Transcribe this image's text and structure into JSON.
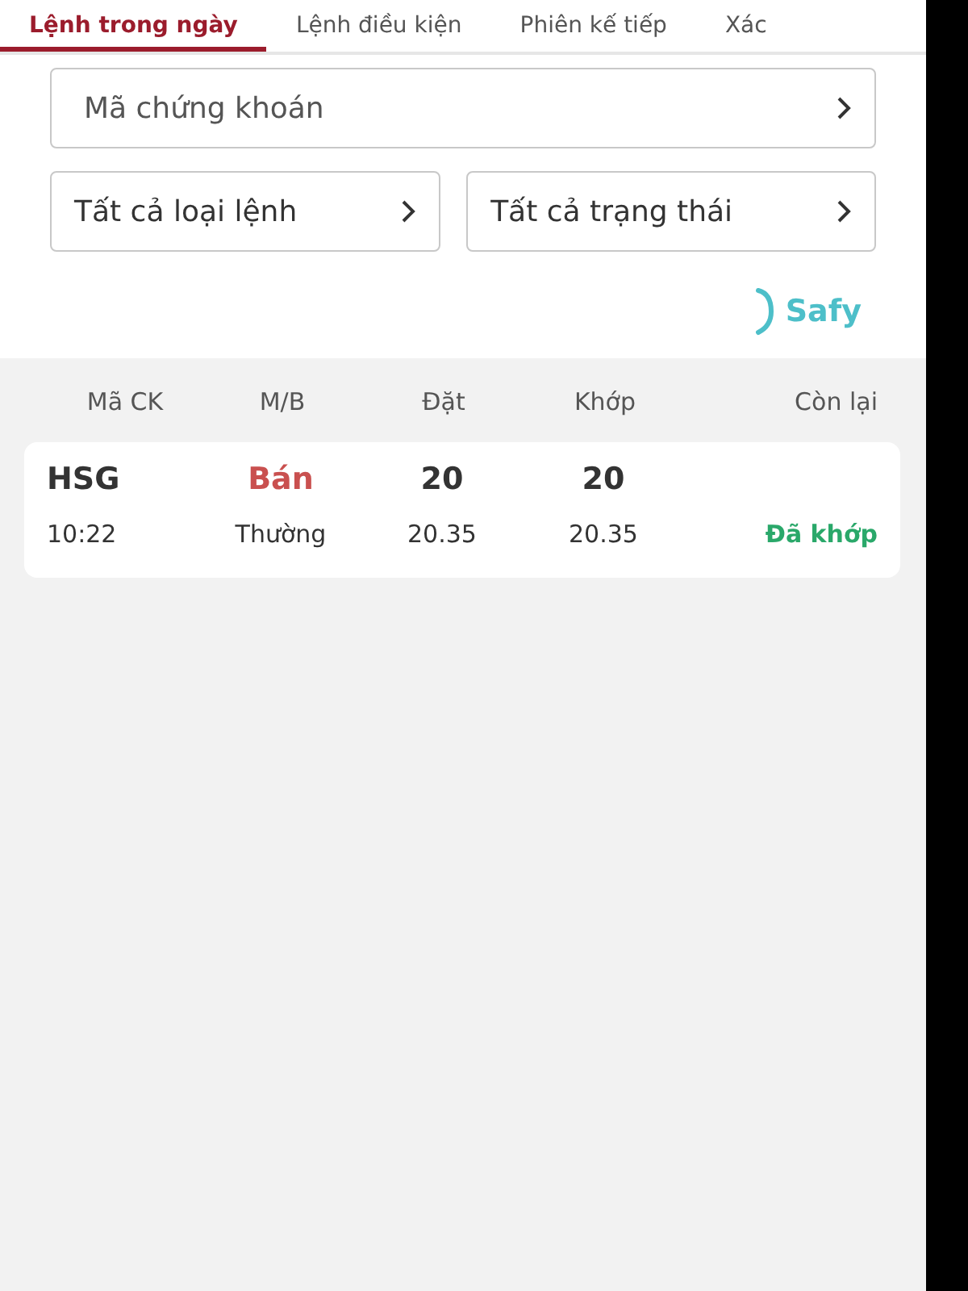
{
  "tabs": [
    {
      "label": "Lệnh trong ngày",
      "selected": true
    },
    {
      "label": "Lệnh điều kiện",
      "selected": false
    },
    {
      "label": "Phiên kế tiếp",
      "selected": false
    },
    {
      "label": "Xác",
      "selected": false
    }
  ],
  "filters": {
    "symbol": {
      "placeholder": "Mã chứng khoán"
    },
    "order_type": "Tất cả loại lệnh",
    "status": "Tất cả trạng thái"
  },
  "brand": "Safy",
  "table": {
    "columns": [
      "Mã CK",
      "M/B",
      "Đặt",
      "Khớp",
      "Còn lại"
    ],
    "rows": [
      {
        "symbol": "HSG",
        "side": {
          "text": "Bán",
          "color": "#c9504f"
        },
        "qty": "20",
        "matched_qty": "20",
        "time": "10:22",
        "order_type": "Thường",
        "price": "20.35",
        "matched_price": "20.35",
        "status": {
          "text": "Đã khớp",
          "color": "#2aa86a"
        }
      }
    ]
  }
}
